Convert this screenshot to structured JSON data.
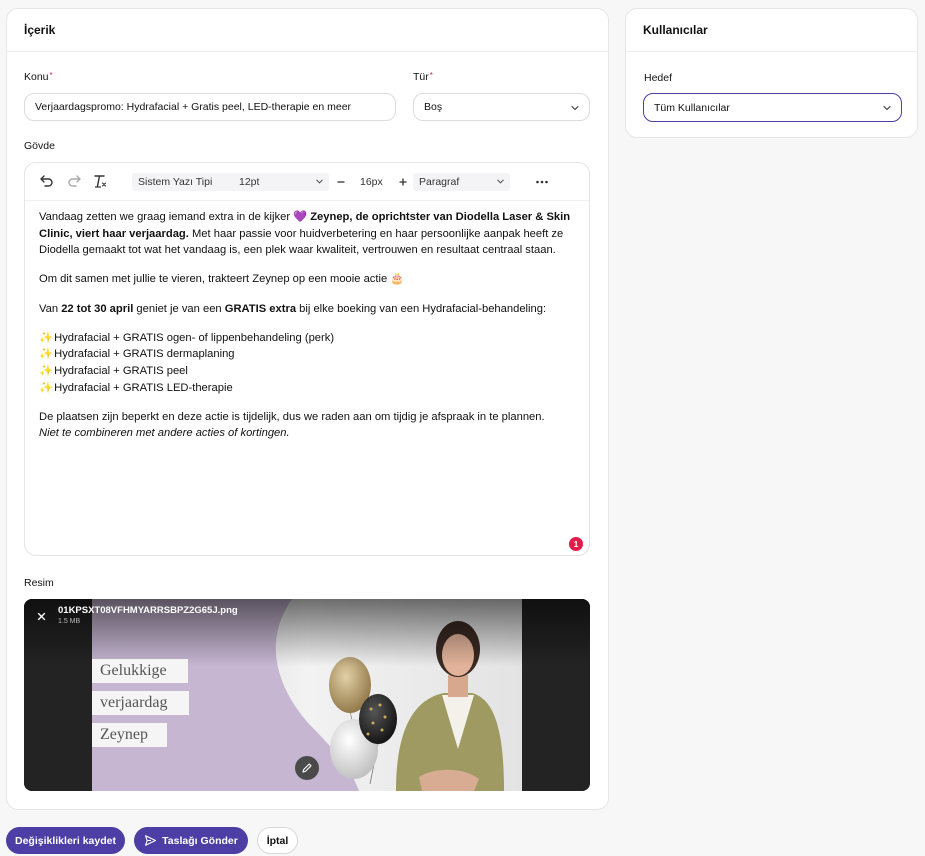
{
  "content_card": {
    "title": "İçerik",
    "subject": {
      "label": "Konu",
      "value": "Verjaardagspromo: Hydrafacial + Gratis peel, LED-therapie en meer"
    },
    "type": {
      "label": "Tür",
      "value": "Boş"
    },
    "body_label": "Gövde",
    "toolbar": {
      "undo_icon": "undo-icon",
      "redo_icon": "redo-icon",
      "clear_format_icon": "clear-formatting-icon",
      "font_family": "Sistem Yazı Tipi",
      "font_size": "12pt",
      "line_height": "16px",
      "block_format": "Paragraf",
      "more_icon": "more-horizontal-icon"
    },
    "body": {
      "p1_a": "Vandaag zetten we graag iemand extra in de kijker ",
      "p1_emoji": "💜",
      "p1_bold": " Zeynep, de oprichtster van Diodella Laser & Skin Clinic, viert haar verjaardag.",
      "p1_b": " Met haar passie voor huidverbetering en haar persoonlijke aanpak heeft ze Diodella gemaakt tot wat het vandaag is, een plek waar kwaliteit, vertrouwen en resultaat centraal staan.",
      "p2_a": "Om dit samen met jullie te vieren, trakteert Zeynep op een mooie actie ",
      "p2_emoji": "🎂",
      "p3_a": "Van ",
      "p3_bold1": "22 tot 30 april",
      "p3_b": " geniet je van een ",
      "p3_bold2": "GRATIS extra",
      "p3_c": " bij elke boeking van een Hydrafacial-behandeling:",
      "list_emoji": "✨",
      "list": [
        "Hydrafacial + GRATIS ogen- of lippenbehandeling (perk)",
        "Hydrafacial + GRATIS dermaplaning",
        "Hydrafacial + GRATIS peel",
        "Hydrafacial + GRATIS LED-therapie"
      ],
      "p4": "De plaatsen zijn beperkt en deze actie is tijdelijk, dus we raden aan om tijdig je afspraak in te plannen.",
      "p4_italic": "Niet te combineren met andere acties of kortingen."
    },
    "notification_count": "1",
    "image": {
      "label": "Resim",
      "file_name": "01KPSXT08VFHMYARRSBPZ2G65J.png",
      "file_size": "1.5 MB",
      "remove_icon": "close-icon",
      "edit_icon": "pencil-icon",
      "text_line1": "Gelukkige",
      "text_line2": "verjaardag",
      "text_line3": "Zeynep"
    }
  },
  "users_card": {
    "title": "Kullanıcılar",
    "target": {
      "label": "Hedef",
      "value": "Tüm Kullanıcılar"
    }
  },
  "actions": {
    "save_label": "Değişiklikleri kaydet",
    "send_label": "Taslağı Gönder",
    "send_icon": "send-icon",
    "cancel_label": "İptal"
  },
  "colors": {
    "primary": "#4c3ea5",
    "required": "#e11d48",
    "banner_purple": "#c6b6d2"
  }
}
